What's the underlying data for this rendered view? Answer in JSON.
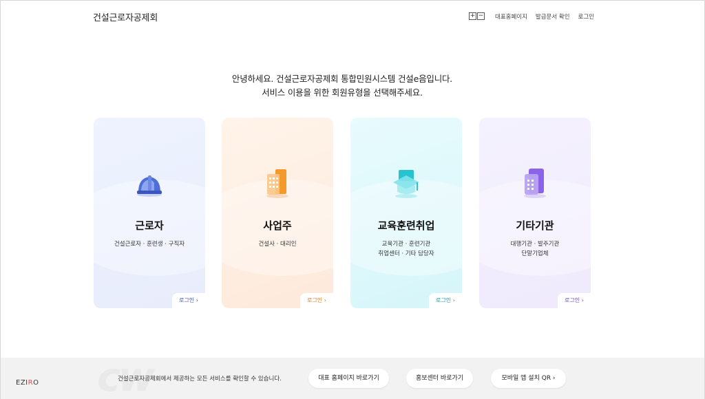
{
  "header": {
    "brand": "건설근로자공제회",
    "zoom_in": "+",
    "zoom_out": "−",
    "links": [
      "대표홈페이지",
      "발급문서 확인",
      "로그인"
    ]
  },
  "greeting": {
    "line1": "안녕하세요. 건설근로자공제회 통합민원시스템 건설e음입니다.",
    "line2": "서비스 이용을 위한 회원유형을 선택해주세요."
  },
  "cards": [
    {
      "title": "근로자",
      "desc1": "건설근로자 · 훈련생 · 구직자",
      "desc2": "",
      "login": "로그인 ›",
      "icon": "helmet-icon"
    },
    {
      "title": "사업주",
      "desc1": "건설사 · 대리인",
      "desc2": "",
      "login": "로그인 ›",
      "icon": "building-icon"
    },
    {
      "title": "교육훈련취업",
      "desc1": "교육기관 · 훈련기관",
      "desc2": "취업센터 · 기타 담당자",
      "login": "로그인 ›",
      "icon": "graduation-icon"
    },
    {
      "title": "기타기관",
      "desc1": "대행기관 · 발주기관",
      "desc2": "단말기업체",
      "login": "로그인 ›",
      "icon": "office-icon"
    }
  ],
  "footer": {
    "text": "건설근로자공제회에서 제공하는 모든 서비스를 확인할 수 있습니다.",
    "buttons": [
      "대표 홈페이지 바로가기",
      "홍보센터 바로가기",
      "모바일 앱 설치 QR ›"
    ],
    "logo_main": "EZI",
    "logo_accent": "R",
    "logo_tail": "O"
  },
  "colors": {
    "worker": "#5b7be0",
    "employer": "#f5a03a",
    "education": "#2ccfd8",
    "other": "#8a6ae0"
  }
}
